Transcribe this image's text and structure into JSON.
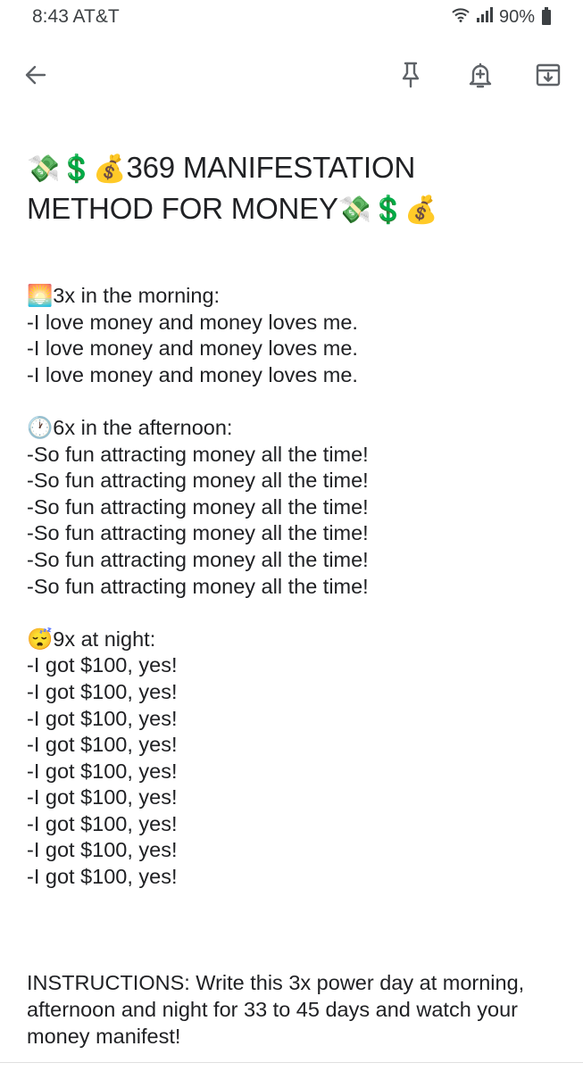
{
  "status": {
    "time": "8:43 AT&T",
    "battery": "90%"
  },
  "toolbar": {
    "icons": [
      "back-arrow-icon",
      "pin-icon",
      "reminder-icon",
      "archive-icon"
    ]
  },
  "note": {
    "title_line1": "369 MANIFESTATION",
    "title_line2": "METHOD FOR MONEY",
    "title_emojis": [
      "💸",
      "💲",
      "💰"
    ],
    "morning": {
      "emoji": "🌅",
      "header": "3x in the morning:",
      "lines": [
        "-I love money and money loves me.",
        "-I love money and money loves me.",
        "-I love money and money loves me."
      ]
    },
    "afternoon": {
      "emoji": "🕐",
      "header": "6x in the afternoon:",
      "lines": [
        "-So fun attracting money all the time!",
        "-So fun attracting money all the time!",
        "-So fun attracting money all the time!",
        "-So fun attracting money all the time!",
        "-So fun attracting money all the time!",
        "-So fun attracting money all the time!"
      ]
    },
    "night": {
      "emoji": "😴",
      "header": "9x at night:",
      "lines": [
        "-I got $100, yes!",
        "-I got $100, yes!",
        "-I got $100, yes!",
        "-I got $100, yes!",
        "-I got $100, yes!",
        "-I got $100, yes!",
        "-I got $100, yes!",
        "-I got $100, yes!",
        "-I got $100, yes!"
      ]
    },
    "instructions": "INSTRUCTIONS: Write this 3x power day at morning, afternoon and night for 33 to 45 days and watch your money manifest!"
  }
}
